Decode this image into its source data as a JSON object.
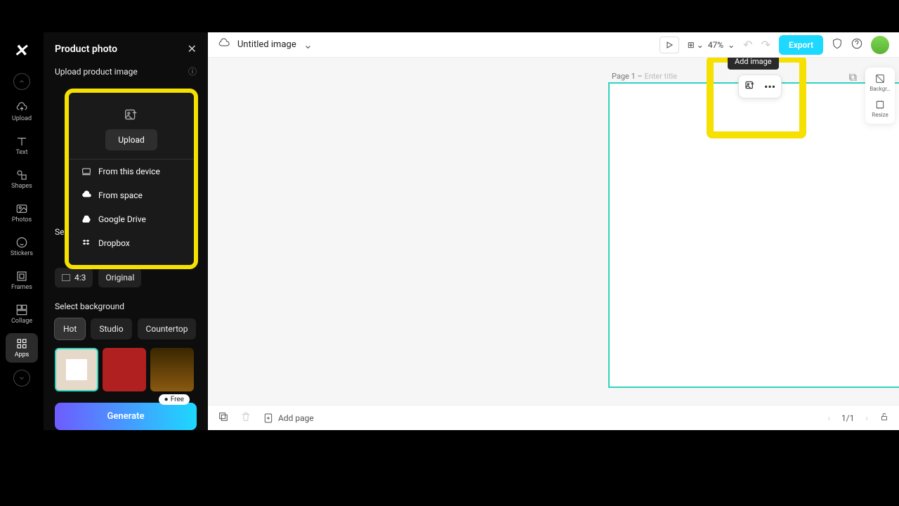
{
  "panel": {
    "title": "Product photo",
    "upload_section": "Upload product image",
    "upload_button": "Upload",
    "sources": {
      "device": "From this device",
      "space": "From space",
      "gdrive": "Google Drive",
      "dropbox": "Dropbox"
    },
    "select_size_partial": "Se",
    "ratios": {
      "r43": "4:3",
      "original": "Original"
    },
    "select_bg": "Select background",
    "bg_tabs": {
      "hot": "Hot",
      "studio": "Studio",
      "countertop": "Countertop"
    },
    "generate": "Generate",
    "free_badge": "Free"
  },
  "nav": {
    "upload": "Upload",
    "text": "Text",
    "shapes": "Shapes",
    "photos": "Photos",
    "stickers": "Stickers",
    "frames": "Frames",
    "collage": "Collage",
    "apps": "Apps"
  },
  "topbar": {
    "title": "Untitled image",
    "zoom": "47%",
    "export": "Export"
  },
  "tooltip": "Add image",
  "page": {
    "label": "Page 1 –",
    "placeholder": "Enter title"
  },
  "bottom": {
    "addpage": "Add page",
    "pagecount": "1/1"
  },
  "dock": {
    "bg": "Backgr…",
    "resize": "Resize"
  }
}
